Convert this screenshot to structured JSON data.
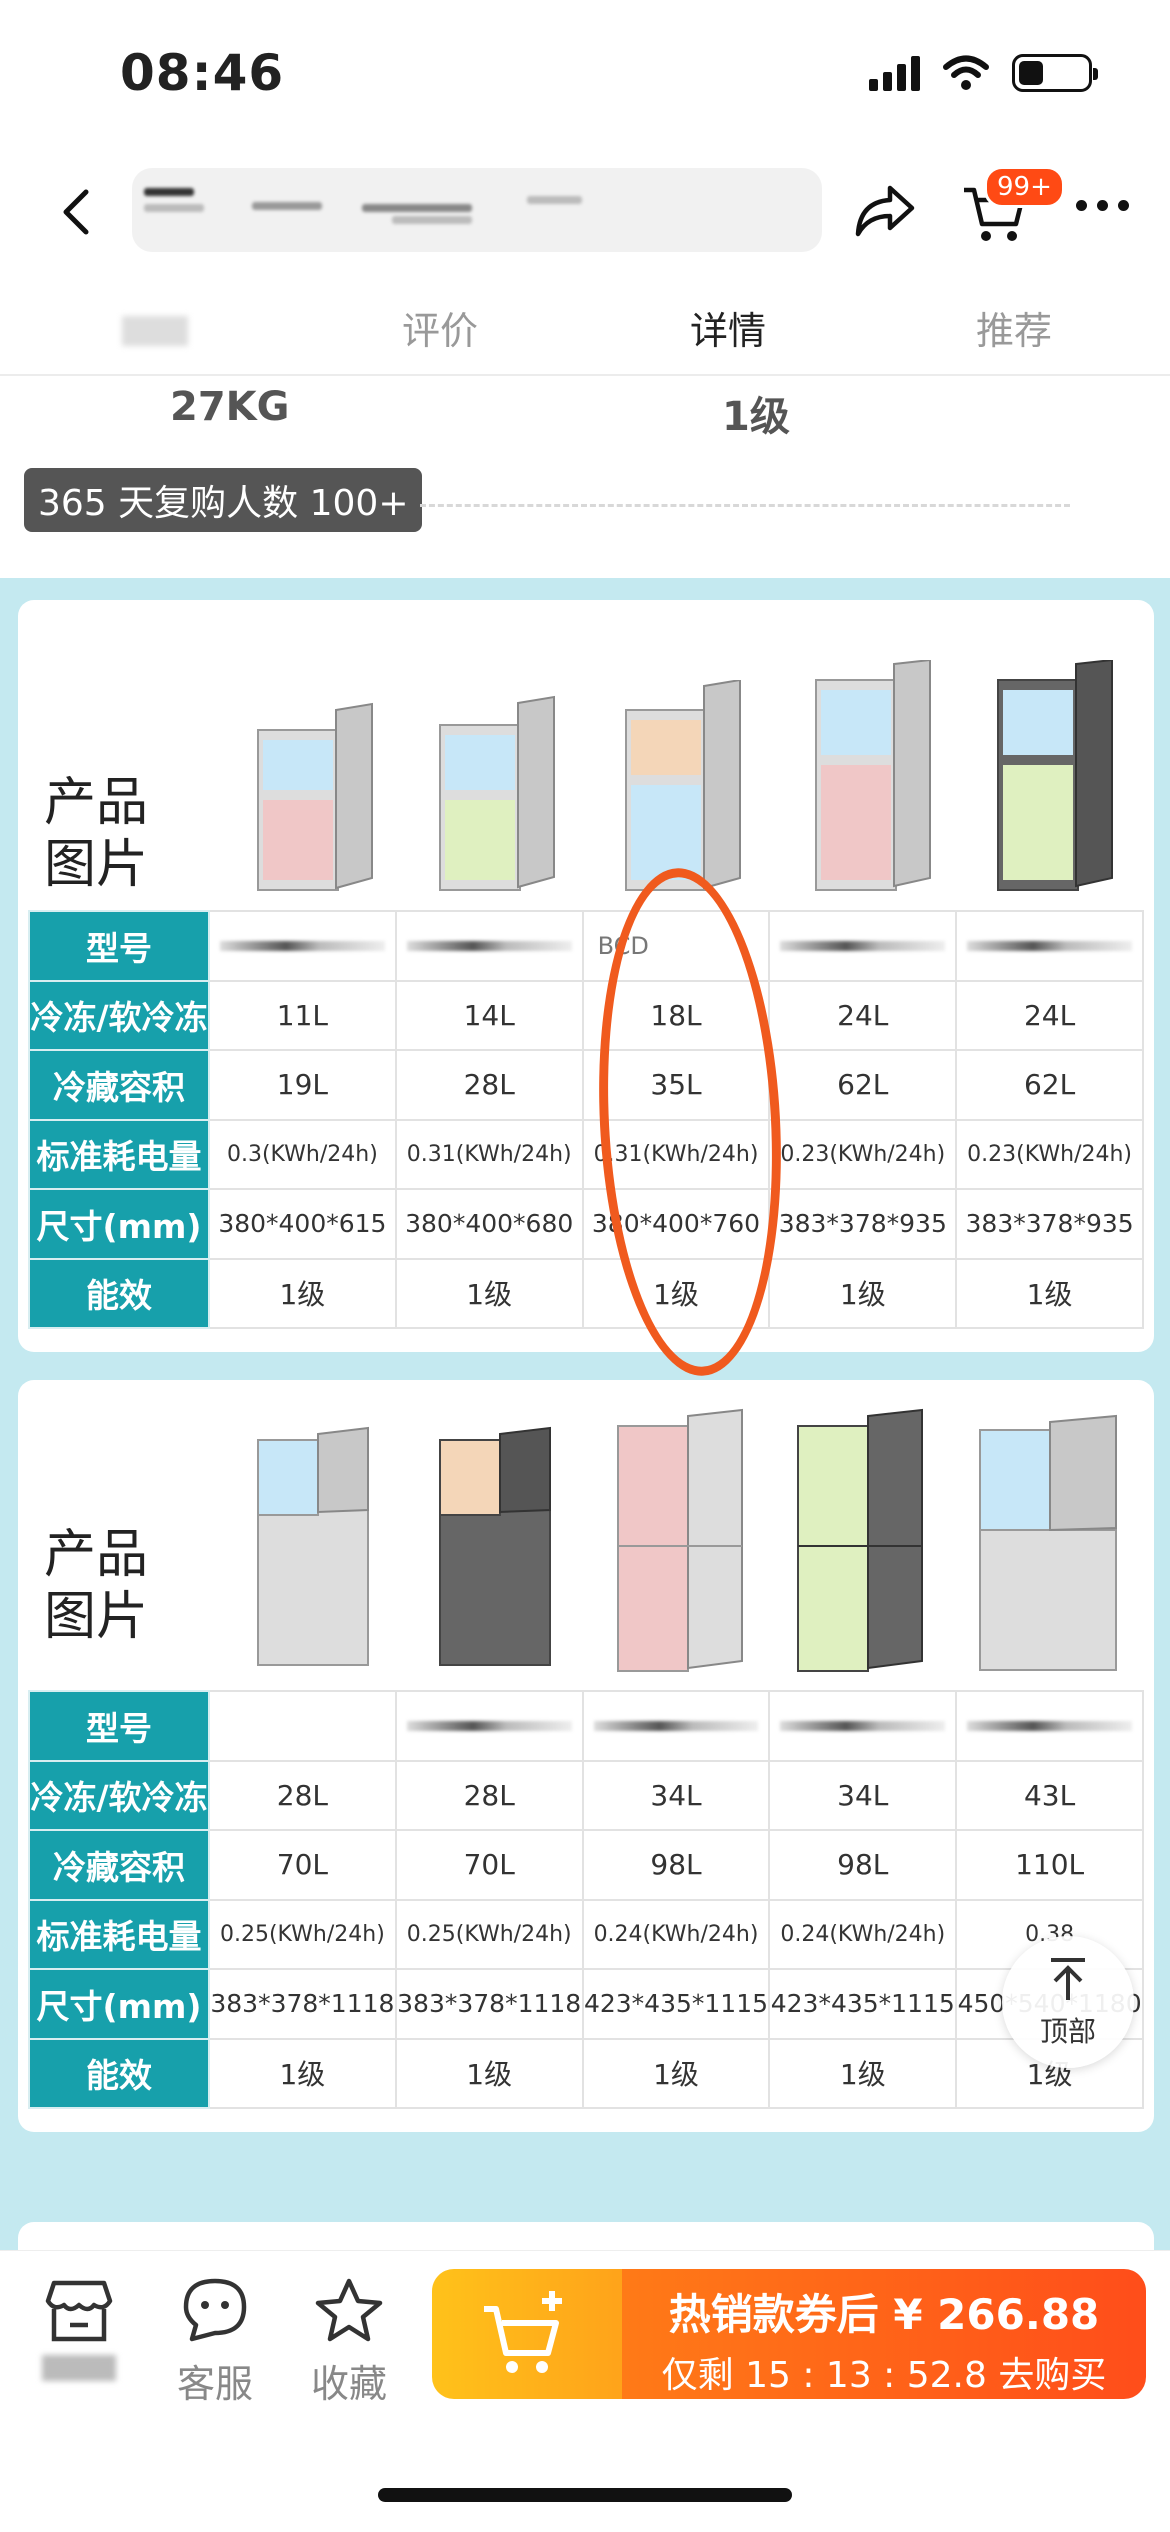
{
  "status": {
    "time": "08:46"
  },
  "header": {
    "cart_badge": "99+"
  },
  "tabs": [
    {
      "label": "评价"
    },
    {
      "label": "详情"
    },
    {
      "label": "推荐"
    }
  ],
  "spec_values": {
    "weight": "27KG",
    "energy": "1级"
  },
  "repurchase": "365 天复购人数 100+",
  "table1": {
    "title_line1": "产品",
    "title_line2": "图片",
    "row_labels": [
      "型号",
      "冷冻/软冷冻",
      "冷藏容积",
      "标准耗电量",
      "尺寸(mm)",
      "能效"
    ],
    "model_partial": "BCD",
    "freeze": [
      "11L",
      "14L",
      "18L",
      "24L",
      "24L"
    ],
    "fridge": [
      "19L",
      "28L",
      "35L",
      "62L",
      "62L"
    ],
    "power": [
      "0.3(KWh/24h)",
      "0.31(KWh/24h)",
      "0.31(KWh/24h)",
      "0.23(KWh/24h)",
      "0.23(KWh/24h)"
    ],
    "size": [
      "380*400*615",
      "380*400*680",
      "380*400*760",
      "383*378*935",
      "383*378*935"
    ],
    "energy": [
      "1级",
      "1级",
      "1级",
      "1级",
      "1级"
    ]
  },
  "table2": {
    "title_line1": "产品",
    "title_line2": "图片",
    "row_labels": [
      "型号",
      "冷冻/软冷冻",
      "冷藏容积",
      "标准耗电量",
      "尺寸(mm)",
      "能效"
    ],
    "freeze": [
      "28L",
      "28L",
      "34L",
      "34L",
      "43L"
    ],
    "fridge": [
      "70L",
      "70L",
      "98L",
      "98L",
      "110L"
    ],
    "power": [
      "0.25(KWh/24h)",
      "0.25(KWh/24h)",
      "0.24(KWh/24h)",
      "0.24(KWh/24h)",
      "0.38"
    ],
    "size": [
      "383*378*1118",
      "383*378*1118",
      "423*435*1115",
      "423*435*1115",
      "450*540*1180"
    ],
    "energy": [
      "1级",
      "1级",
      "1级",
      "1级",
      "1级"
    ]
  },
  "to_top": "顶部",
  "bottom": {
    "service": "客服",
    "favorite": "收藏",
    "buy_line1": "热销款券后 ¥ 266.88",
    "buy_line2": "仅剩 15 : 13 : 52.8 去购买"
  },
  "colors": {
    "accent": "#17a0ab",
    "badge": "#ff4a14",
    "buy": "#ff5a1a",
    "highlight_circle": "#f05a1e"
  }
}
